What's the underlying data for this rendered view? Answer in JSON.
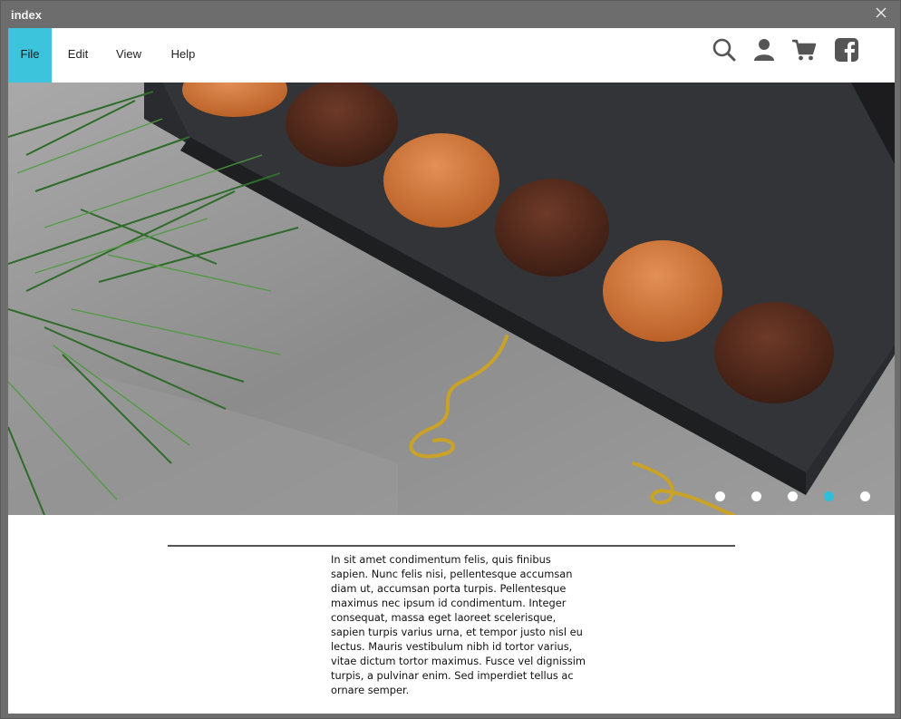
{
  "window": {
    "title": "index"
  },
  "menu": {
    "items": [
      {
        "label": "File",
        "active": true
      },
      {
        "label": "Edit",
        "active": false
      },
      {
        "label": "View",
        "active": false
      },
      {
        "label": "Help",
        "active": false
      }
    ]
  },
  "toolbar": {
    "icons": [
      "search-icon",
      "user-icon",
      "cart-icon",
      "facebook-icon"
    ]
  },
  "carousel": {
    "slide_count": 5,
    "active_index": 3,
    "accent_color": "#2ec0da"
  },
  "content": {
    "paragraph": "In sit amet condimentum felis, quis finibus sapien. Nunc felis nisi, pellentesque accumsan diam ut, accumsan porta turpis. Pellentesque maximus nec ipsum id condimentum. Integer consequat, massa eget laoreet scelerisque, sapien turpis varius urna, et tempor justo nisl eu lectus. Mauris vestibulum nibh id tortor varius, vitae dictum tortor maximus. Fusce vel dignissim turpis, a pulvinar enim. Sed imperdiet tellus ac ornare semper."
  },
  "colors": {
    "menu_active": "#3cc4dd",
    "window_frame": "#6d6d6d"
  }
}
